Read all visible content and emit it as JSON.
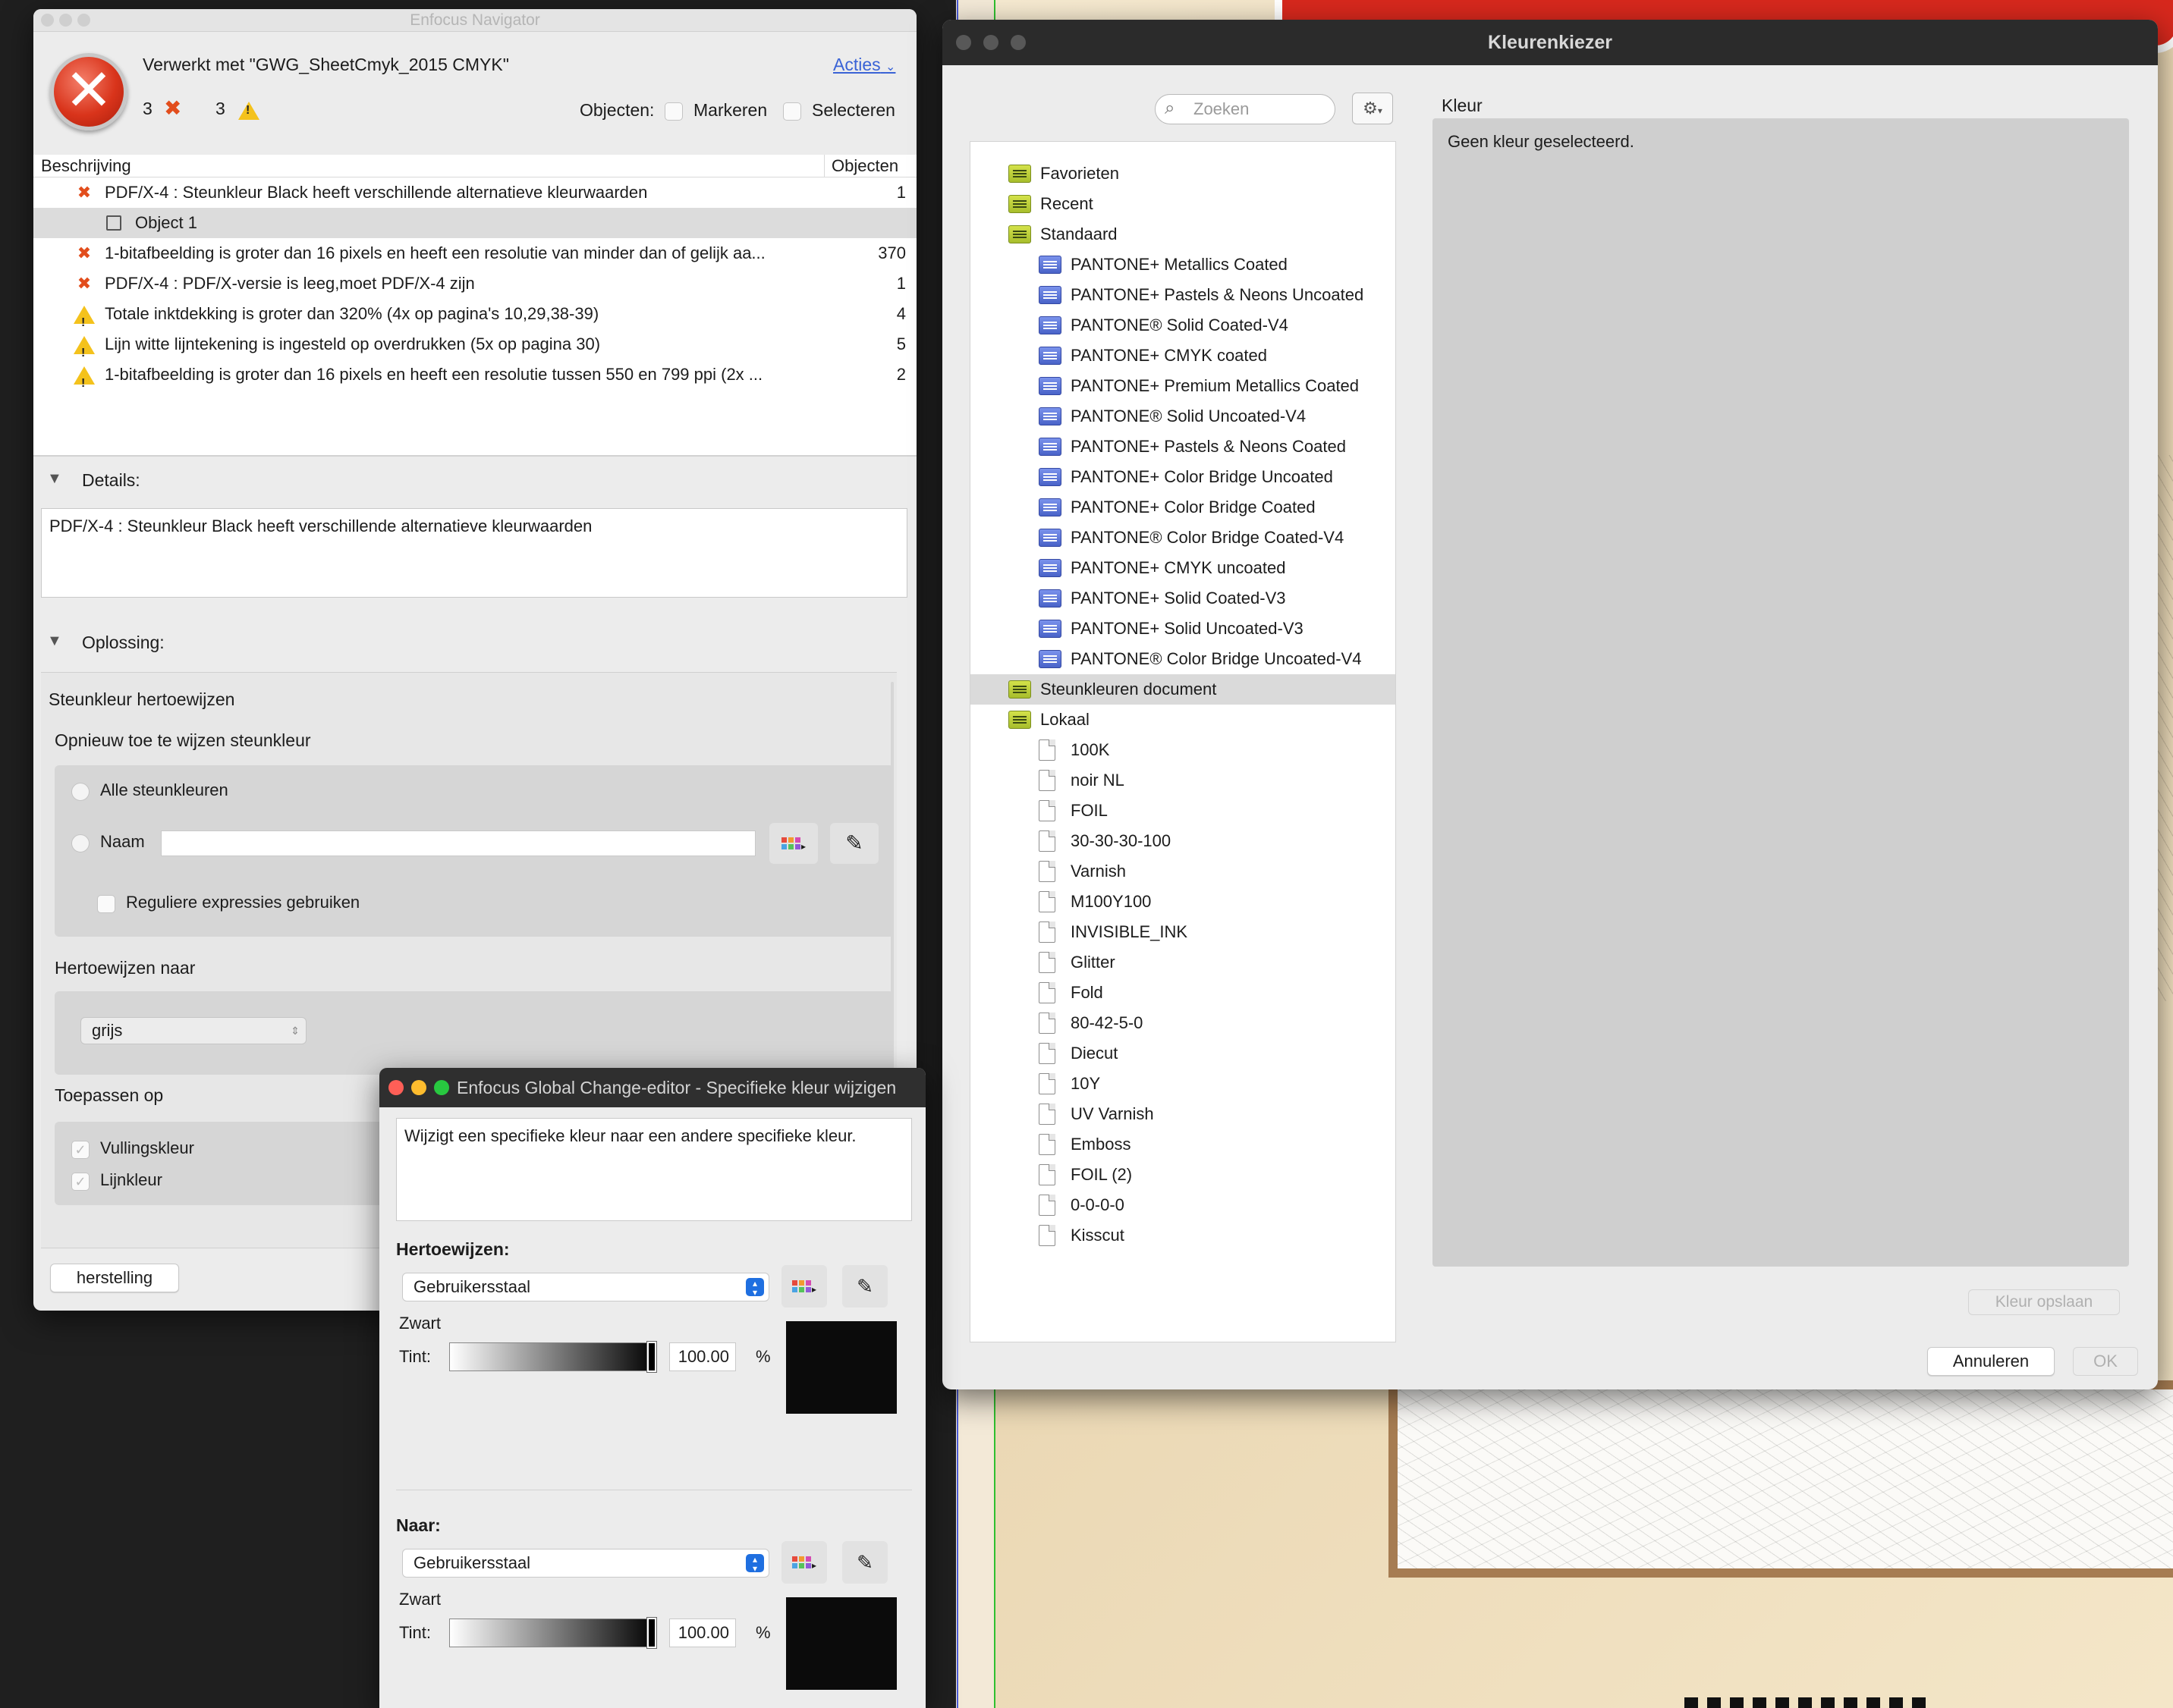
{
  "navigator": {
    "window_title": "Enfocus Navigator",
    "processed_label": "Verwerkt met \"GWG_SheetCmyk_2015 CMYK\"",
    "actions_label": "Acties",
    "error_count": "3",
    "warning_count": "3",
    "objects_label": "Objecten:",
    "mark_label": "Markeren",
    "select_label": "Selecteren",
    "list_headers": {
      "description": "Beschrijving",
      "objects": "Objecten"
    },
    "issues": [
      {
        "type": "error",
        "text": "PDF/X-4 : Steunkleur Black heeft verschillende alternatieve kleurwaarden",
        "count": "1"
      },
      {
        "type": "object",
        "text": "Object 1",
        "count": ""
      },
      {
        "type": "error",
        "text": "1-bitafbeelding is groter dan 16 pixels en heeft een resolutie van minder dan of gelijk aa...",
        "count": "370"
      },
      {
        "type": "error",
        "text": "PDF/X-4 : PDF/X-versie is leeg,moet PDF/X-4 zijn",
        "count": "1"
      },
      {
        "type": "warning",
        "text": "Totale inktdekking is groter dan 320%  (4x op pagina's 10,29,38-39)",
        "count": "4"
      },
      {
        "type": "warning",
        "text": "Lijn witte lijntekening is ingesteld op overdrukken (5x op pagina 30)",
        "count": "5"
      },
      {
        "type": "warning",
        "text": "1-bitafbeelding is groter dan 16 pixels en heeft een resolutie tussen 550 en 799 ppi (2x ...",
        "count": "2"
      }
    ],
    "details_label": "Details:",
    "details_text": "PDF/X-4 : Steunkleur Black heeft verschillende alternatieve kleurwaarden",
    "solution_label": "Oplossing:",
    "solution_title": "Steunkleur hertoewijzen",
    "reassign_heading": "Opnieuw toe te wijzen steunkleur",
    "all_spot_label": "Alle steunkleuren",
    "name_label": "Naam",
    "name_value": "",
    "regex_label": "Reguliere expressies gebruiken",
    "reassign_to_label": "Hertoewijzen naar",
    "reassign_to_value": "grijs",
    "apply_to_label": "Toepassen op",
    "fill_label": "Vullingskleur",
    "stroke_label": "Lijnkleur",
    "restore_button": "herstelling"
  },
  "kleurenkiezer": {
    "window_title": "Kleurenkiezer",
    "search_placeholder": "Zoeken",
    "color_label": "Kleur",
    "no_color_text": "Geen kleur geselecteerd.",
    "save_color_button": "Kleur opslaan",
    "cancel_button": "Annuleren",
    "ok_button": "OK",
    "tree": [
      {
        "label": "Favorieten",
        "icon": "folder-icon",
        "level": 0
      },
      {
        "label": "Recent",
        "icon": "folder-icon",
        "level": 0
      },
      {
        "label": "Standaard",
        "icon": "folder-icon",
        "level": 0
      },
      {
        "label": "PANTONE+ Metallics Coated",
        "icon": "swatchbook-icon",
        "level": 1
      },
      {
        "label": "PANTONE+ Pastels & Neons Uncoated",
        "icon": "swatchbook-icon",
        "level": 1
      },
      {
        "label": "PANTONE® Solid Coated-V4",
        "icon": "swatchbook-icon",
        "level": 1
      },
      {
        "label": "PANTONE+ CMYK coated",
        "icon": "swatchbook-icon",
        "level": 1
      },
      {
        "label": "PANTONE+ Premium Metallics Coated",
        "icon": "swatchbook-icon",
        "level": 1
      },
      {
        "label": "PANTONE® Solid Uncoated-V4",
        "icon": "swatchbook-icon",
        "level": 1
      },
      {
        "label": "PANTONE+ Pastels & Neons Coated",
        "icon": "swatchbook-icon",
        "level": 1
      },
      {
        "label": "PANTONE+ Color Bridge Uncoated",
        "icon": "swatchbook-icon",
        "level": 1
      },
      {
        "label": "PANTONE+ Color Bridge Coated",
        "icon": "swatchbook-icon",
        "level": 1
      },
      {
        "label": "PANTONE® Color Bridge Coated-V4",
        "icon": "swatchbook-icon",
        "level": 1
      },
      {
        "label": "PANTONE+ CMYK uncoated",
        "icon": "swatchbook-icon",
        "level": 1
      },
      {
        "label": "PANTONE+ Solid Coated-V3",
        "icon": "swatchbook-icon",
        "level": 1
      },
      {
        "label": "PANTONE+ Solid Uncoated-V3",
        "icon": "swatchbook-icon",
        "level": 1
      },
      {
        "label": "PANTONE® Color Bridge Uncoated-V4",
        "icon": "swatchbook-icon",
        "level": 1
      },
      {
        "label": "Steunkleuren document",
        "icon": "folder-icon",
        "level": 0,
        "selected": true
      },
      {
        "label": "Lokaal",
        "icon": "folder-icon",
        "level": 0
      },
      {
        "label": "100K",
        "icon": "page-icon",
        "level": 1
      },
      {
        "label": "noir NL",
        "icon": "page-icon",
        "level": 1
      },
      {
        "label": "FOIL",
        "icon": "page-icon",
        "level": 1
      },
      {
        "label": "30-30-30-100",
        "icon": "page-icon",
        "level": 1
      },
      {
        "label": "Varnish",
        "icon": "page-icon",
        "level": 1
      },
      {
        "label": "M100Y100",
        "icon": "page-icon",
        "level": 1
      },
      {
        "label": "INVISIBLE_INK",
        "icon": "page-icon",
        "level": 1
      },
      {
        "label": "Glitter",
        "icon": "page-icon",
        "level": 1
      },
      {
        "label": "Fold",
        "icon": "page-icon",
        "level": 1
      },
      {
        "label": "80-42-5-0",
        "icon": "page-icon",
        "level": 1
      },
      {
        "label": "Diecut",
        "icon": "page-icon",
        "level": 1
      },
      {
        "label": "10Y",
        "icon": "page-icon",
        "level": 1
      },
      {
        "label": "UV Varnish",
        "icon": "page-icon",
        "level": 1
      },
      {
        "label": "Emboss",
        "icon": "page-icon",
        "level": 1
      },
      {
        "label": "FOIL (2)",
        "icon": "page-icon",
        "level": 1
      },
      {
        "label": "0-0-0-0",
        "icon": "page-icon",
        "level": 1
      },
      {
        "label": "Kisscut",
        "icon": "page-icon",
        "level": 1
      }
    ]
  },
  "change_editor": {
    "window_title": "Enfocus Global Change-editor - Specifieke kleur wijzigen",
    "description": "Wijzigt een specifieke kleur naar een andere specifieke kleur.",
    "reassign_label": "Hertoewijzen:",
    "from": {
      "source": "Gebruikersstaal",
      "color_name": "Zwart",
      "tint_label": "Tint:",
      "tint_value": "100.00",
      "unit": "%",
      "tint_fraction": 1.0
    },
    "to_label": "Naar:",
    "to": {
      "source": "Gebruikersstaal",
      "color_name": "Zwart",
      "tint_label": "Tint:",
      "tint_value": "100.00",
      "unit": "%",
      "tint_fraction": 1.0
    }
  },
  "colors": {
    "error": "#e24d1c",
    "warning": "#f4c21c",
    "link": "#3a63d6",
    "swatch_black": "#0b0b0b",
    "accent": "#1f6fe0"
  }
}
